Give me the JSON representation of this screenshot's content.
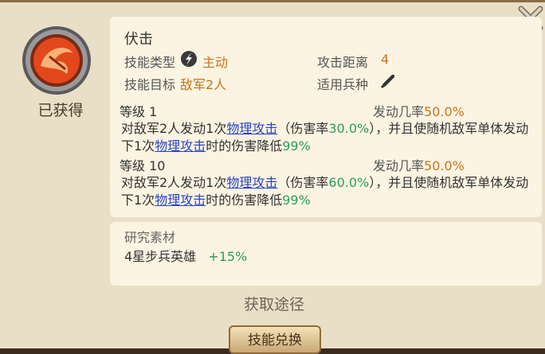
{
  "status": {
    "owned_label": "已获得"
  },
  "skill": {
    "name": "伏击",
    "type_label": "技能类型",
    "type_icon": "lightning-slash-icon",
    "type_value": "主动",
    "range_label": "攻击距离",
    "range_value": "4",
    "target_label": "技能目标",
    "target_value": "敌军2人",
    "troop_label": "适用兵种",
    "troop_icon": "crossed-sword-icon"
  },
  "levels": [
    {
      "label": "等级  1",
      "chance_label": "发动几率",
      "chance_value": "50.0%",
      "desc_a": "对敌军2人发动1次",
      "link1": "物理攻击",
      "desc_b": "（伤害率",
      "rate": "30.0%",
      "desc_c": "），并且使随机敌军单体发动下1次",
      "link2": "物理攻击",
      "desc_d": "时的伤害降低",
      "reduction": "99%"
    },
    {
      "label": "等级  10",
      "chance_label": "发动几率",
      "chance_value": "50.0%",
      "desc_a": "对敌军2人发动1次",
      "link1": "物理攻击",
      "desc_b": "（伤害率",
      "rate": "60.0%",
      "desc_c": "），并且使随机敌军单体发动下1次",
      "link2": "物理攻击",
      "desc_d": "时的伤害降低",
      "reduction": "99%"
    }
  ],
  "research": {
    "title": "研究素材",
    "item": "4星步兵英雄",
    "bonus": "+15%"
  },
  "buttons": {
    "obtain": "获取途径",
    "exchange": "技能兑换"
  },
  "colors": {
    "accent_orange": "#c8731c",
    "link_blue": "#2a44c8",
    "value_green": "#2aa05a"
  }
}
